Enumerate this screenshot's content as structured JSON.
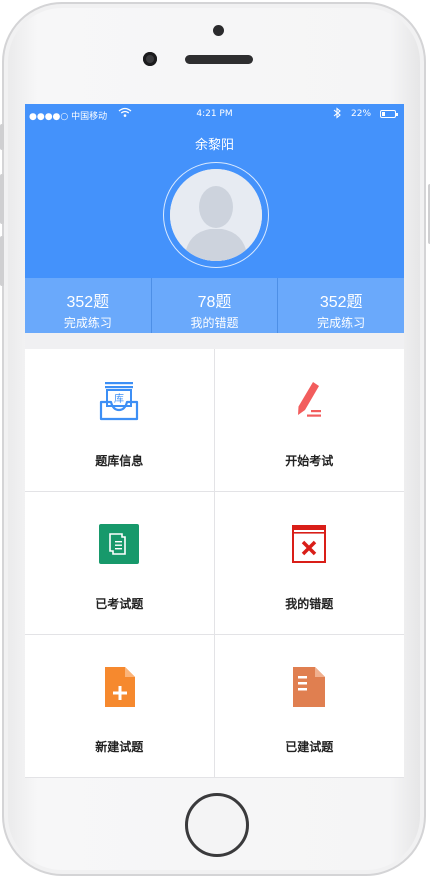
{
  "status_bar": {
    "carrier": "●●●●○ 中国移动",
    "time": "4:21 PM",
    "battery": "22%",
    "battery_level": 0.22
  },
  "profile": {
    "name": "余黎阳"
  },
  "stats": [
    {
      "value": "352题",
      "label": "完成练习"
    },
    {
      "value": "78题",
      "label": "我的错题"
    },
    {
      "value": "352题",
      "label": "完成练习"
    }
  ],
  "menu": [
    {
      "label": "题库信息",
      "icon": "question-bank-icon",
      "color": "#3d8ff5"
    },
    {
      "label": "开始考试",
      "icon": "pen-icon",
      "color": "#f25d5d"
    },
    {
      "label": "已考试题",
      "icon": "document-icon",
      "color": "#17996b"
    },
    {
      "label": "我的错题",
      "icon": "wrong-book-icon",
      "color": "#d91e18"
    },
    {
      "label": "新建试题",
      "icon": "new-file-icon",
      "color": "#f6892e"
    },
    {
      "label": "已建试题",
      "icon": "file-icon",
      "color": "#e07f50"
    }
  ],
  "colors": {
    "header": "#4492fb",
    "stats_bar": "#6aa9fb"
  }
}
